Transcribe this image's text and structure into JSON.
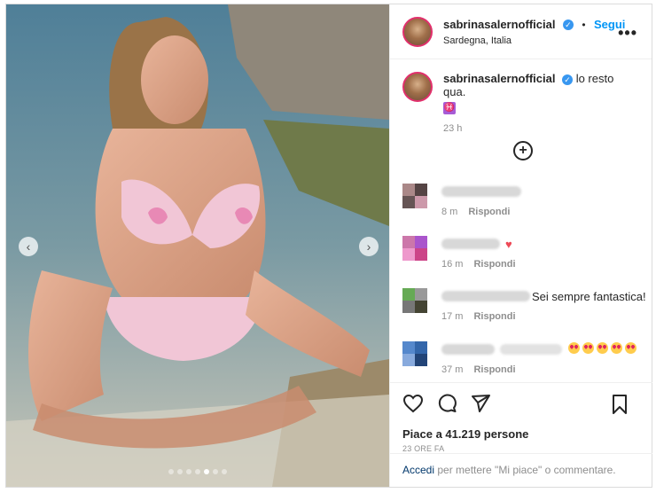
{
  "post": {
    "username": "sabrinasalernofficial",
    "verified_mark": "✓",
    "separator": "•",
    "follow_label": "Segui",
    "location": "Sardegna, Italia",
    "more_label": "•••"
  },
  "caption": {
    "username": "sabrinasalernofficial",
    "verified_mark": "✓",
    "text": "lo resto qua.",
    "emoji": "♓",
    "time": "23 h"
  },
  "load_more_label": "+",
  "comments": [
    {
      "time": "8 m",
      "reply": "Rispondi",
      "text": ""
    },
    {
      "time": "16 m",
      "reply": "Rispondi",
      "text": "♥"
    },
    {
      "time": "17 m",
      "reply": "Rispondi",
      "text": "Sei sempre fantastica!"
    },
    {
      "time": "37 m",
      "reply": "Rispondi",
      "text": ""
    }
  ],
  "actions": {
    "likes": "Piace a 41.219 persone",
    "posted_ago": "23 ORE FA"
  },
  "login": {
    "link": "Accedi",
    "text": " per mettere \"Mi piace\" o commentare."
  },
  "media": {
    "prev_label": "‹",
    "next_label": "›",
    "slides": 7,
    "active_slide": 5
  },
  "colors": {
    "accent": "#0095f6",
    "heart": "#ed4956",
    "verified": "#3897f0"
  },
  "icons": [
    "like-heart-icon",
    "comment-icon",
    "share-icon",
    "bookmark-icon",
    "verified-badge-icon",
    "more-options-icon",
    "add-circle-icon"
  ]
}
